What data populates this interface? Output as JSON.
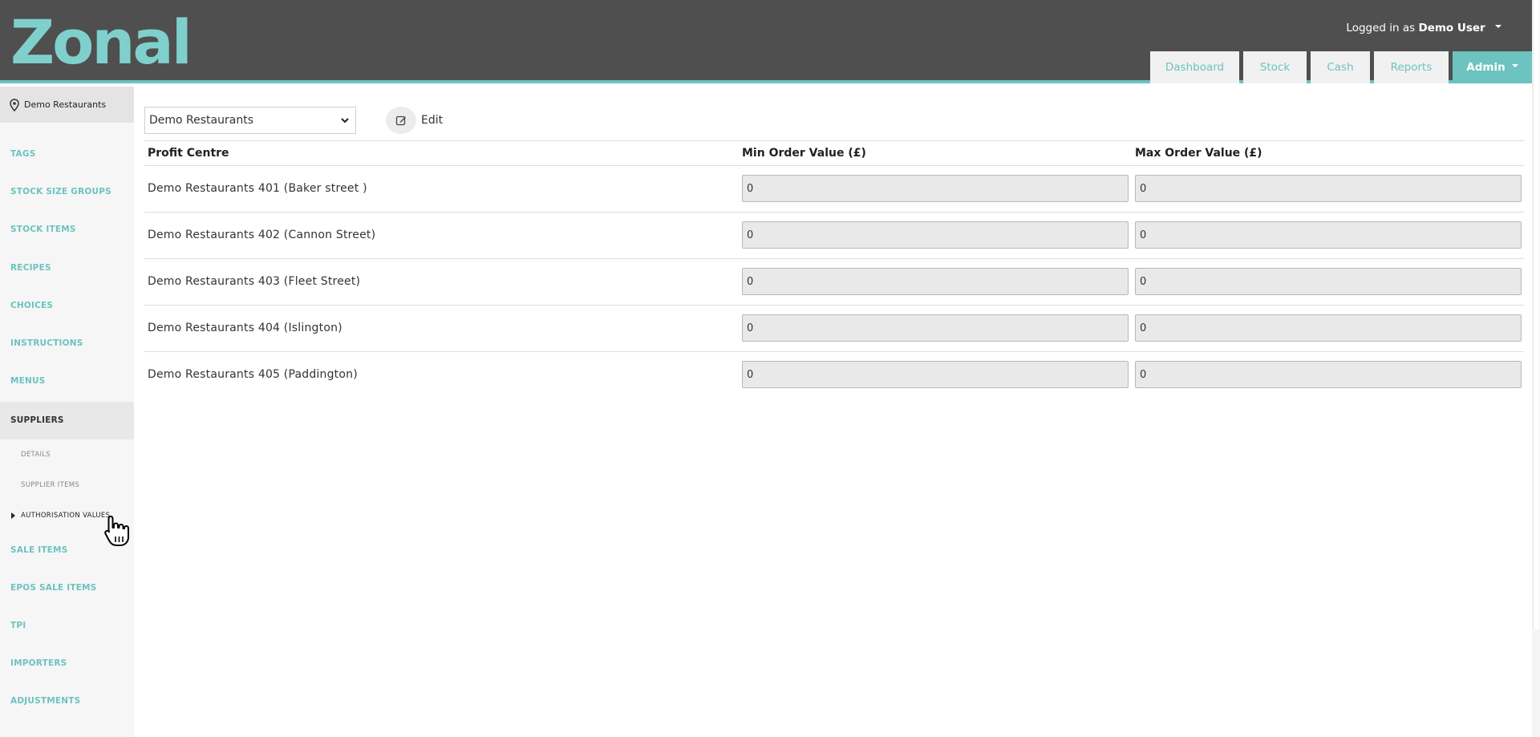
{
  "header": {
    "logo_text": "Zonal",
    "user_prefix": "Logged in as",
    "user_name": "Demo User",
    "nav": [
      {
        "label": "Dashboard"
      },
      {
        "label": "Stock"
      },
      {
        "label": "Cash"
      },
      {
        "label": "Reports"
      },
      {
        "label": "Admin"
      }
    ]
  },
  "sidebar": {
    "location": "Demo Restaurants",
    "items": [
      {
        "label": "TAGS"
      },
      {
        "label": "STOCK SIZE GROUPS"
      },
      {
        "label": "STOCK ITEMS"
      },
      {
        "label": "RECIPES"
      },
      {
        "label": "CHOICES"
      },
      {
        "label": "INSTRUCTIONS"
      },
      {
        "label": "MENUS"
      },
      {
        "label": "SUPPLIERS"
      },
      {
        "label": "SALE ITEMS"
      },
      {
        "label": "EPOS SALE ITEMS"
      },
      {
        "label": "TPI"
      },
      {
        "label": "IMPORTERS"
      },
      {
        "label": "ADJUSTMENTS"
      }
    ],
    "subitems": [
      {
        "label": "DETAILS"
      },
      {
        "label": "SUPPLIER ITEMS"
      },
      {
        "label": "AUTHORISATION VALUES"
      }
    ]
  },
  "toolbar": {
    "selected_site": "Demo Restaurants",
    "edit_label": "Edit"
  },
  "table": {
    "headers": [
      "Profit Centre",
      "Min Order Value (£)",
      "Max Order Value (£)"
    ],
    "rows": [
      {
        "name": "Demo Restaurants 401 (Baker street )",
        "min": "0",
        "max": "0"
      },
      {
        "name": "Demo Restaurants 402 (Cannon Street)",
        "min": "0",
        "max": "0"
      },
      {
        "name": "Demo Restaurants 403 (Fleet Street)",
        "min": "0",
        "max": "0"
      },
      {
        "name": "Demo Restaurants 404 (Islington)",
        "min": "0",
        "max": "0"
      },
      {
        "name": "Demo Restaurants 405 (Paddington)",
        "min": "0",
        "max": "0"
      }
    ]
  },
  "colors": {
    "accent": "#6cc3c0",
    "header_bg": "#4f4f4f"
  }
}
